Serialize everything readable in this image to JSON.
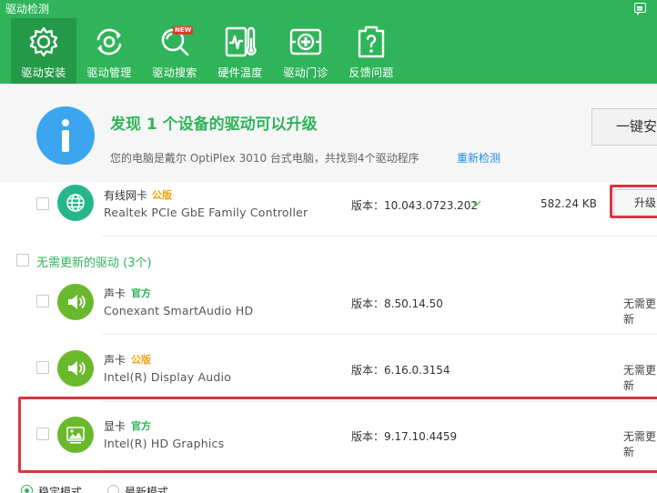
{
  "app": {
    "title": "驱动检测"
  },
  "tabs": [
    {
      "label": "驱动安装",
      "icon": "gear-icon",
      "active": true
    },
    {
      "label": "驱动管理",
      "icon": "refresh-icon",
      "active": false
    },
    {
      "label": "驱动搜索",
      "icon": "search-icon",
      "active": false,
      "badge": "NEW"
    },
    {
      "label": "硬件温度",
      "icon": "temperature-icon",
      "active": false
    },
    {
      "label": "驱动门诊",
      "icon": "clinic-icon",
      "active": false
    },
    {
      "label": "反馈问题",
      "icon": "question-icon",
      "active": false
    }
  ],
  "summary": {
    "title": "发现 1 个设备的驱动可以升级",
    "description": "您的电脑是戴尔 OptiPlex 3010 台式电脑，共找到4个驱动程序",
    "rescan": "重新检测",
    "install_all": "一键安装"
  },
  "upgradable": [
    {
      "name": "有线网卡",
      "tag": "公版",
      "model": "Realtek PCIe GbE Family Controller",
      "version": "版本：10.043.0723.202",
      "size": "582.24 KB",
      "action": "升级",
      "icon": "network-globe-icon"
    }
  ],
  "no_update_section": {
    "title": "无需更新的驱动 (3个)"
  },
  "no_update": [
    {
      "name": "声卡",
      "tag": "官方",
      "model": "Conexant SmartAudio HD",
      "version": "版本：8.50.14.50",
      "status": "无需更新",
      "icon": "speaker-icon"
    },
    {
      "name": "声卡",
      "tag": "公版",
      "model": "Intel(R) Display Audio",
      "version": "版本：6.16.0.3154",
      "status": "无需更新",
      "icon": "speaker-icon"
    },
    {
      "name": "显卡",
      "tag": "官方",
      "model": "Intel(R) HD Graphics",
      "version": "版本：9.17.10.4459",
      "status": "无需更新",
      "icon": "display-image-icon"
    }
  ],
  "modes": [
    {
      "label": "稳定模式",
      "selected": true
    },
    {
      "label": "最新模式",
      "selected": false
    }
  ],
  "colors": {
    "brand_green": "#2fb45a",
    "active_tab": "#249a49",
    "info_blue": "#3ba6ef",
    "tag_orange": "#f5a10b",
    "highlight_red": "#d9363e",
    "link_blue": "#1f8de0"
  }
}
